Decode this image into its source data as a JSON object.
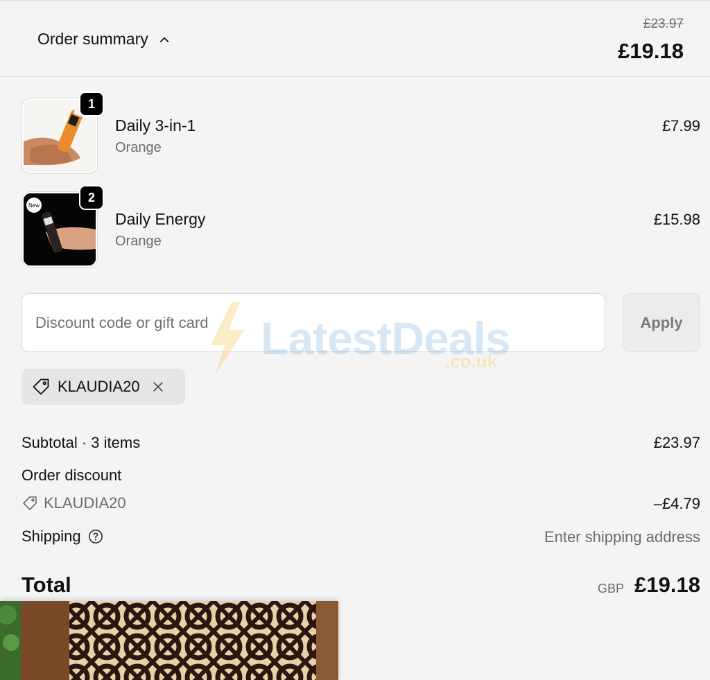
{
  "header": {
    "toggle_label": "Order summary",
    "original_total": "£23.97",
    "total": "£19.18"
  },
  "items": [
    {
      "quantity": "1",
      "name": "Daily 3-in-1",
      "variant": "Orange",
      "price": "£7.99",
      "image": "hand-holding-orange-tube"
    },
    {
      "quantity": "2",
      "name": "Daily Energy",
      "variant": "Orange",
      "price": "£15.98",
      "image": "hand-holding-black-tube",
      "image_badge": "New"
    }
  ],
  "discount": {
    "placeholder": "Discount code or gift card",
    "value": "",
    "apply_label": "Apply",
    "applied_code": "KLAUDIA20"
  },
  "watermark": {
    "text": "LatestDeals",
    "sub": ".co.uk"
  },
  "summary": {
    "subtotal_label": "Subtotal · 3 items",
    "subtotal_value": "£23.97",
    "order_discount_label": "Order discount",
    "discount_code": "KLAUDIA20",
    "discount_value": "–£4.79",
    "shipping_label": "Shipping",
    "shipping_value": "Enter shipping address",
    "total_label": "Total",
    "currency": "GBP",
    "total_value": "£19.18"
  },
  "icons": {
    "chevron": "chevron-up-icon",
    "tag": "tag-icon",
    "remove": "close-icon",
    "help": "question-circle-icon"
  },
  "colors": {
    "background": "#f4f4f4",
    "badge": "#000000",
    "text": "#111111",
    "muted": "#6b6b6b"
  }
}
